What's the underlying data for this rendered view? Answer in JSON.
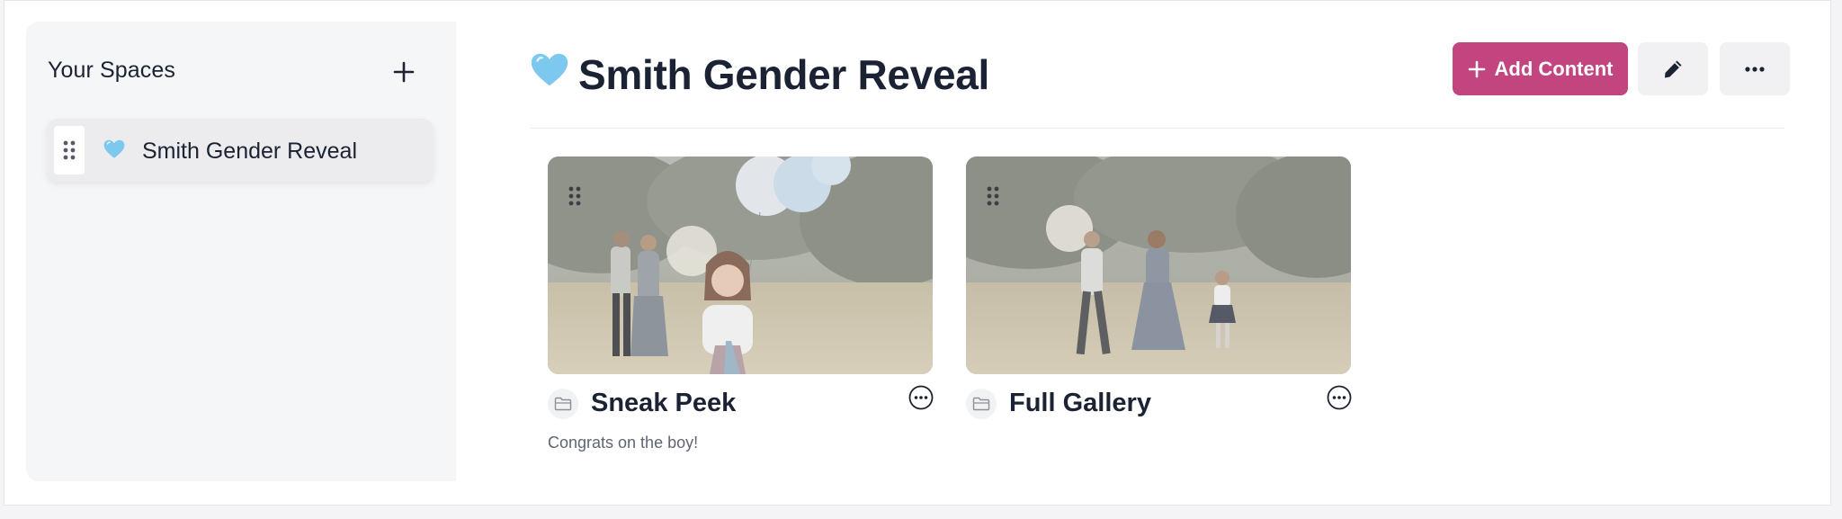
{
  "sidebar": {
    "title": "Your Spaces",
    "add_icon": "plus-icon",
    "items": [
      {
        "emoji": "light-blue-heart",
        "label": "Smith Gender Reveal"
      }
    ]
  },
  "header": {
    "emoji": "light-blue-heart",
    "title": "Smith Gender Reveal",
    "add_content_label": "Add Content",
    "edit_icon": "pencil-icon",
    "more_icon": "ellipsis-icon"
  },
  "cards": [
    {
      "title": "Sneak Peek",
      "description": "Congrats on the boy!",
      "icon": "folder-icon"
    },
    {
      "title": "Full Gallery",
      "description": "",
      "icon": "folder-icon"
    }
  ],
  "colors": {
    "accent": "#c3457f",
    "heart": "#7cc8ee",
    "text": "#1b2233"
  }
}
